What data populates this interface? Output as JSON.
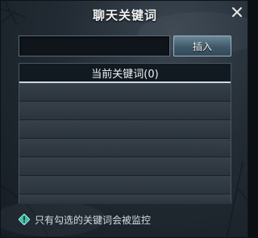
{
  "window": {
    "title": "聊天关键词",
    "close_icon": "close-icon"
  },
  "keyword_input": {
    "value": "",
    "placeholder": ""
  },
  "insert_button": {
    "label": "插入"
  },
  "keyword_list": {
    "header": "当前关键词(0)",
    "rows": [
      "",
      "",
      "",
      "",
      "",
      "",
      ""
    ]
  },
  "footer": {
    "tip_icon": "diamond-info-icon",
    "tip_text": "只有勾选的关键词会被监控"
  },
  "colors": {
    "accent": "#6b8797",
    "header_bg": "#121a21",
    "tip_icon": "#3fbfa8"
  }
}
